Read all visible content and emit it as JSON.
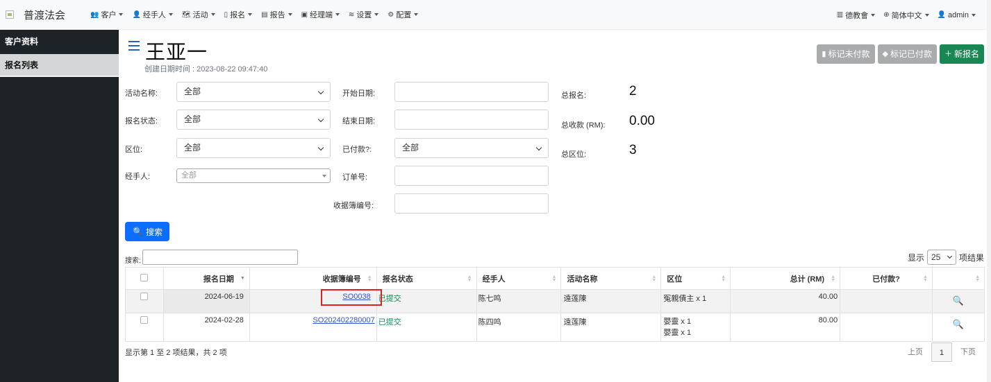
{
  "brand": {
    "name": "普渡法会"
  },
  "nav": [
    {
      "icon": "users-icon",
      "glyph": "👥",
      "label": "客户"
    },
    {
      "icon": "user-icon",
      "glyph": "👤",
      "label": "经手人"
    },
    {
      "icon": "map-icon",
      "glyph": "🗺",
      "label": "活动"
    },
    {
      "icon": "file-icon",
      "glyph": "▯",
      "label": "报名"
    },
    {
      "icon": "report-icon",
      "glyph": "▤",
      "label": "报告"
    },
    {
      "icon": "briefcase-icon",
      "glyph": "▣",
      "label": "经理端"
    },
    {
      "icon": "sliders-icon",
      "glyph": "≋",
      "label": "设置"
    },
    {
      "icon": "gear-icon",
      "glyph": "⚙",
      "label": "配置"
    }
  ],
  "nav_right": [
    {
      "icon": "building-icon",
      "glyph": "▥",
      "label": "德教會"
    },
    {
      "icon": "globe-icon",
      "glyph": "⊕",
      "label": "简体中文"
    },
    {
      "icon": "person-icon",
      "glyph": "👤",
      "label": "admin"
    }
  ],
  "sidebar": {
    "items": [
      {
        "label": "客户资料"
      },
      {
        "label": "报名列表"
      }
    ]
  },
  "page": {
    "title": "王亚一",
    "subtitle": "创建日期时间 : 2023-08-22 09:47:40"
  },
  "actions": {
    "mark_unpaid": "标记未付款",
    "mark_paid": "标记已付款",
    "new": "新报名"
  },
  "filters": {
    "activity": {
      "label": "活动名称:",
      "value": "全部"
    },
    "status": {
      "label": "报名状态:",
      "value": "全部"
    },
    "zone": {
      "label": "区位:",
      "value": "全部"
    },
    "agent": {
      "label": "经手人:",
      "value": "全部"
    },
    "start": {
      "label": "开始日期:"
    },
    "end": {
      "label": "结束日期:"
    },
    "paid": {
      "label": "已付款?:",
      "value": "全部"
    },
    "order": {
      "label": "订单号:"
    },
    "receipt": {
      "label": "收据簿编号:"
    }
  },
  "stats": {
    "total_reg": {
      "label": "总报名:",
      "value": "2"
    },
    "total_collected": {
      "label": "总收款 (RM):",
      "value": "0.00"
    },
    "total_zone": {
      "label": "总区位:",
      "value": "3"
    }
  },
  "search_button": "搜索",
  "table_controls": {
    "search_label": "搜索:",
    "show_label": "显示",
    "page_size": "25",
    "entries_label": "项结果"
  },
  "table": {
    "headers": [
      "报名日期",
      "收据簿编号",
      "报名状态",
      "经手人",
      "活动名称",
      "区位",
      "总计 (RM)",
      "已付款?"
    ],
    "rows": [
      {
        "date": "2024-06-19",
        "receipt": "SO0038",
        "status": "已提交",
        "agent": "陈七鸣",
        "activity": "遠莲陳",
        "zone": [
          "冤親債主 x 1"
        ],
        "total": "40.00",
        "paid": ""
      },
      {
        "date": "2024-02-28",
        "receipt": "SO202402280007",
        "status": "已提交",
        "agent": "陈四鸣",
        "activity": "遠莲陳",
        "zone": [
          "嬰靈 x 1",
          "嬰靈 x 1"
        ],
        "total": "80.00",
        "paid": ""
      }
    ]
  },
  "footer": {
    "info": "显示第 1 至 2 项结果，共 2 项",
    "prev": "上页",
    "page": "1",
    "next": "下页"
  }
}
